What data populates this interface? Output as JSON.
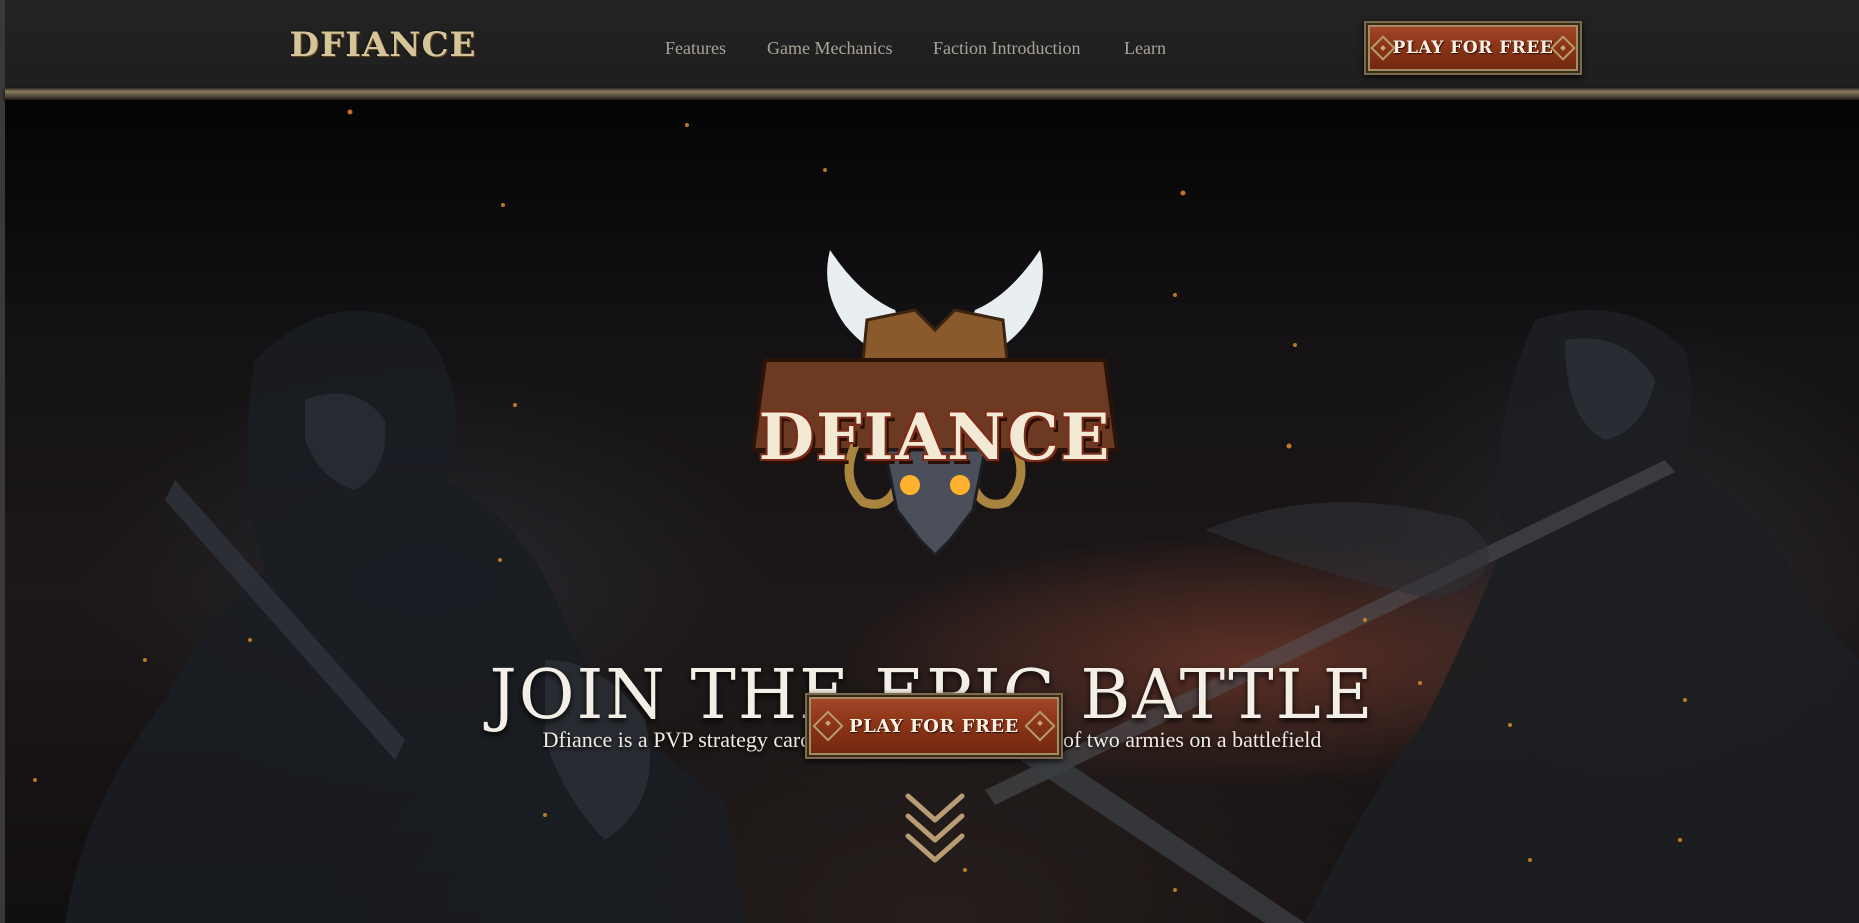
{
  "header": {
    "logo_text": "DFIANCE",
    "nav": [
      "Features",
      "Game Mechanics",
      "Faction Introduction",
      "Learn"
    ],
    "cta_label": "PLAY FOR FREE"
  },
  "hero": {
    "logo_text": "DFIANCE",
    "title": "JOIN THE EPIC BATTLE",
    "subtitle": "Dfiance is a PVP strategy card game that simulates a clash of two armies on a battlefield",
    "cta_label": "PLAY FOR FREE",
    "scroll_icon": "double-chevron-down-icon"
  },
  "colors": {
    "header_bg": "#232323",
    "nav_text": "#a9a398",
    "button_red": "#8c3518",
    "button_border": "#a48c61",
    "title_text": "#f4efe6"
  }
}
